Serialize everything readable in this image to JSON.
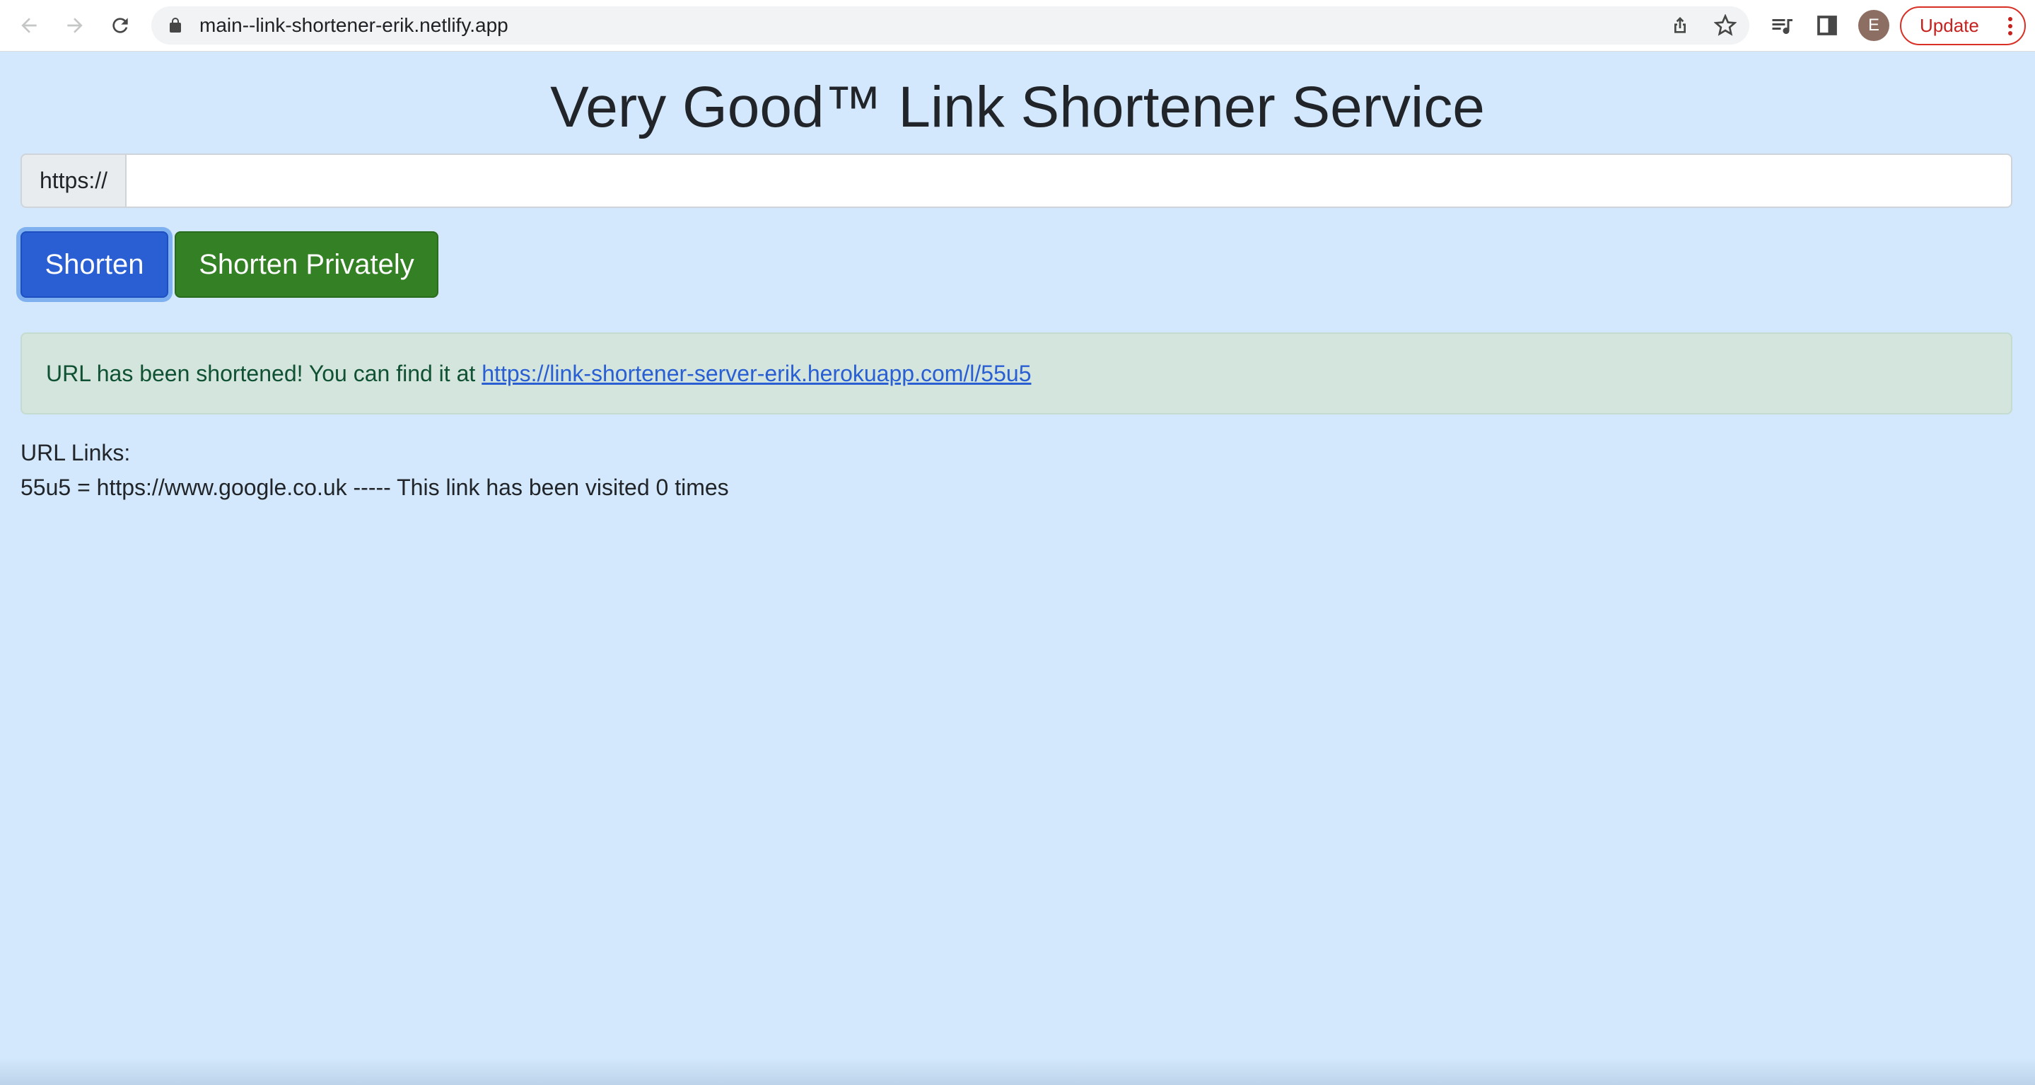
{
  "browser": {
    "url": "main--link-shortener-erik.netlify.app",
    "profile_initial": "E",
    "update_label": "Update"
  },
  "page": {
    "title": "Very Good™ Link Shortener Service",
    "url_prefix": "https://",
    "url_input_value": "",
    "shorten_label": "Shorten",
    "shorten_private_label": "Shorten Privately",
    "alert": {
      "message": "URL has been shortened! You can find it at",
      "link": "https://link-shortener-server-erik.herokuapp.com/l/55u5"
    },
    "links_heading": "URL Links:",
    "links": [
      {
        "text": "55u5 = https://www.google.co.uk ----- This link has been visited 0 times"
      }
    ]
  },
  "colors": {
    "background": "#d3e8fc",
    "primary": "#2a5fd4",
    "success": "#348024",
    "alert_bg": "#d3e5dd",
    "alert_text": "#0f5132",
    "update_red": "#c5221f"
  }
}
